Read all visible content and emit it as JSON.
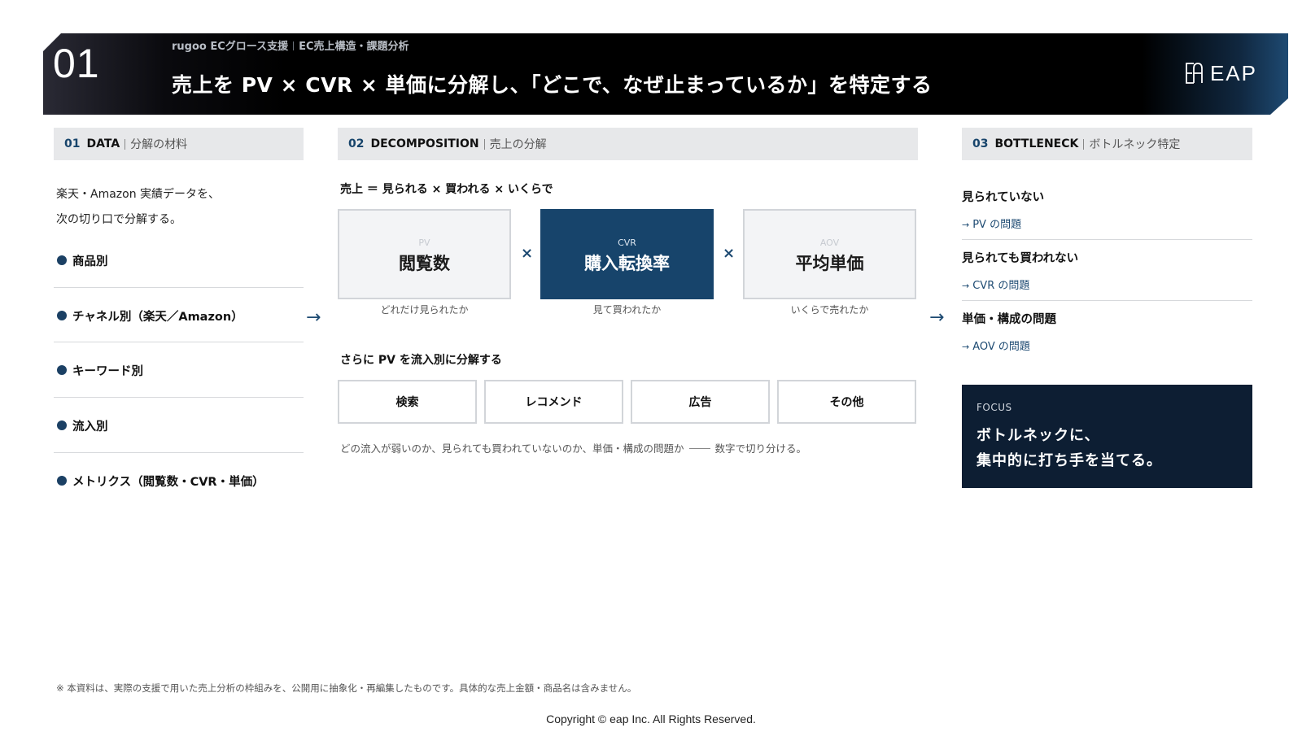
{
  "header": {
    "number": "01",
    "subtitle_left": "rugoo ECグロース支援",
    "subtitle_right": "EC売上構造・課題分析",
    "title": "売上を PV × CVR × 単価に分解し、「どこで、なぜ止まっているか」を特定する",
    "logo_text": "EAP",
    "colors": {
      "accent": "#17446b",
      "dark": "#0d1e33",
      "panel": "#e7e8ea"
    }
  },
  "sections": {
    "data": {
      "num": "01",
      "en": "DATA",
      "jp": "分解の材料"
    },
    "decomposition": {
      "num": "02",
      "en": "DECOMPOSITION",
      "jp": "売上の分解"
    },
    "bottleneck": {
      "num": "03",
      "en": "BOTTLENECK",
      "jp": "ボトルネック特定"
    }
  },
  "data_col": {
    "intro_line1": "楽天・Amazon 実績データを、",
    "intro_line2": "次の切り口で分解する。",
    "items": [
      "商品別",
      "チャネル別（楽天／Amazon）",
      "キーワード別",
      "流入別",
      "メトリクス（閲覧数・CVR・単価）"
    ]
  },
  "decomp": {
    "formula": "売上 ＝ 見られる × 買われる × いくらで",
    "times": "×",
    "metrics": [
      {
        "abbr": "PV",
        "name": "閲覧数",
        "desc": "どれだけ見られたか"
      },
      {
        "abbr": "CVR",
        "name": "購入転換率",
        "desc": "見て買われたか"
      },
      {
        "abbr": "AOV",
        "name": "平均単価",
        "desc": "いくらで売れたか"
      }
    ],
    "sub_title": "さらに PV を流入別に分解する",
    "channels": [
      "検索",
      "レコメンド",
      "広告",
      "その他"
    ],
    "note_before": "どの流入が弱いのか、見られても買われていないのか、単価・構成の問題か",
    "note_after": "数字で切り分ける。"
  },
  "arrows": {
    "glyph": "→"
  },
  "bottleneck_col": {
    "items": [
      {
        "title": "見られていない",
        "link": "PV の問題"
      },
      {
        "title": "見られても買われない",
        "link": "CVR の問題"
      },
      {
        "title": "単価・構成の問題",
        "link": "AOV の問題"
      }
    ],
    "link_arrow": "→",
    "focus": {
      "label": "FOCUS",
      "line1": "ボトルネックに、",
      "line2": "集中的に打ち手を当てる。"
    }
  },
  "footer": {
    "disclaimer": "※ 本資料は、実際の支援で用いた売上分析の枠組みを、公開用に抽象化・再編集したものです。具体的な売上金額・商品名は含みません。",
    "copyright": "Copyright © eap Inc. All Rights Reserved."
  }
}
